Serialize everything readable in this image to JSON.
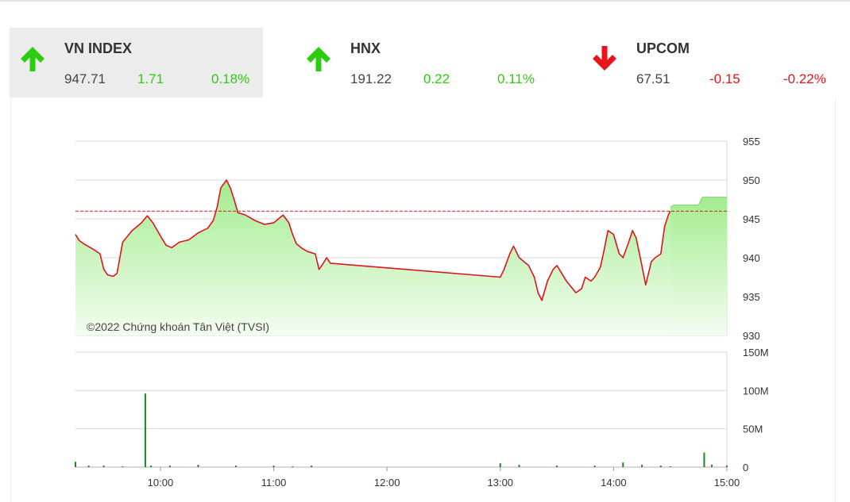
{
  "indices": [
    {
      "name": "VN INDEX",
      "value": "947.71",
      "change": "1.71",
      "pct": "0.18%",
      "direction": "up",
      "active": true
    },
    {
      "name": "HNX",
      "value": "191.22",
      "change": "0.22",
      "pct": "0.11%",
      "direction": "up",
      "active": false
    },
    {
      "name": "UPCOM",
      "value": "67.51",
      "change": "-0.15",
      "pct": "-0.22%",
      "direction": "down",
      "active": false
    }
  ],
  "colors": {
    "up": "#2ecc0e",
    "down": "#e8141c",
    "line": "#e0141c",
    "area_top": "#a3ec8f",
    "area_bottom": "#f4fdf1",
    "volume": "#1a8a1a",
    "grid": "#d9d9d9",
    "reference": "#e0141c"
  },
  "chart_data": {
    "type": "line",
    "copyright": "©2022 Chứng khoán Tân Việt (TVSI)",
    "reference_value": 946,
    "price_axis": {
      "min": 930,
      "max": 955,
      "ticks": [
        "955",
        "950",
        "945",
        "940",
        "935",
        "930"
      ]
    },
    "volume_axis": {
      "min": 0,
      "max": 150,
      "unit": "M",
      "ticks": [
        "150M",
        "100M",
        "50M",
        "0"
      ]
    },
    "time_axis": {
      "start": "09:15",
      "end": "15:00",
      "ticks": [
        "10:00",
        "11:00",
        "12:00",
        "13:00",
        "14:00",
        "15:00"
      ]
    },
    "series": [
      {
        "values": [
          [
            "09:15",
            943.0
          ],
          [
            "09:17",
            942.2
          ],
          [
            "09:20",
            941.7
          ],
          [
            "09:25",
            941.0
          ],
          [
            "09:28",
            940.5
          ],
          [
            "09:30",
            938.5
          ],
          [
            "09:32",
            937.8
          ],
          [
            "09:35",
            937.6
          ],
          [
            "09:37",
            938.0
          ],
          [
            "09:40",
            942.0
          ],
          [
            "09:45",
            943.5
          ],
          [
            "09:50",
            944.5
          ],
          [
            "09:53",
            945.4
          ],
          [
            "09:56",
            944.5
          ],
          [
            "10:00",
            942.8
          ],
          [
            "10:03",
            941.6
          ],
          [
            "10:06",
            941.3
          ],
          [
            "10:10",
            942.0
          ],
          [
            "10:15",
            942.3
          ],
          [
            "10:20",
            943.2
          ],
          [
            "10:25",
            943.8
          ],
          [
            "10:28",
            944.8
          ],
          [
            "10:30",
            946.5
          ],
          [
            "10:32",
            949.0
          ],
          [
            "10:35",
            950.0
          ],
          [
            "10:37",
            949.0
          ],
          [
            "10:39",
            947.5
          ],
          [
            "10:41",
            945.8
          ],
          [
            "10:45",
            945.5
          ],
          [
            "10:50",
            944.8
          ],
          [
            "10:55",
            944.3
          ],
          [
            "11:00",
            944.5
          ],
          [
            "11:03",
            945.1
          ],
          [
            "11:05",
            945.5
          ],
          [
            "11:08",
            944.5
          ],
          [
            "11:10",
            943.0
          ],
          [
            "11:12",
            941.8
          ],
          [
            "11:15",
            941.2
          ],
          [
            "11:18",
            940.8
          ],
          [
            "11:22",
            940.5
          ],
          [
            "11:24",
            938.5
          ],
          [
            "11:26",
            939.2
          ],
          [
            "11:28",
            940.0
          ],
          [
            "11:30",
            939.3
          ],
          [
            "13:00",
            937.5
          ],
          [
            "13:02",
            938.5
          ],
          [
            "13:05",
            940.5
          ],
          [
            "13:07",
            941.5
          ],
          [
            "13:10",
            940.0
          ],
          [
            "13:15",
            939.0
          ],
          [
            "13:18",
            937.5
          ],
          [
            "13:20",
            935.5
          ],
          [
            "13:22",
            934.5
          ],
          [
            "13:25",
            937.0
          ],
          [
            "13:28",
            938.5
          ],
          [
            "13:30",
            939.0
          ],
          [
            "13:35",
            937.0
          ],
          [
            "13:40",
            935.5
          ],
          [
            "13:43",
            936.0
          ],
          [
            "13:45",
            937.5
          ],
          [
            "13:48",
            937.0
          ],
          [
            "13:50",
            937.5
          ],
          [
            "13:53",
            938.8
          ],
          [
            "13:55",
            941.0
          ],
          [
            "13:57",
            943.5
          ],
          [
            "14:00",
            943.0
          ],
          [
            "14:03",
            940.5
          ],
          [
            "14:05",
            940.0
          ],
          [
            "14:08",
            942.0
          ],
          [
            "14:10",
            943.5
          ],
          [
            "14:12",
            942.5
          ],
          [
            "14:15",
            939.0
          ],
          [
            "14:17",
            936.5
          ],
          [
            "14:20",
            939.5
          ],
          [
            "14:22",
            940.0
          ],
          [
            "14:25",
            940.5
          ],
          [
            "14:27",
            944.0
          ],
          [
            "14:29",
            945.5
          ],
          [
            "14:30",
            946.0
          ]
        ]
      },
      {
        "values": [
          [
            "14:30",
            946.5
          ],
          [
            "14:32",
            946.8
          ],
          [
            "14:45",
            946.8
          ],
          [
            "14:47",
            947.8
          ],
          [
            "15:00",
            947.8
          ]
        ]
      }
    ],
    "volume": [
      [
        "09:15",
        7
      ],
      [
        "09:22",
        2
      ],
      [
        "09:30",
        2
      ],
      [
        "09:40",
        1
      ],
      [
        "09:52",
        96
      ],
      [
        "09:55",
        2
      ],
      [
        "10:05",
        2
      ],
      [
        "10:20",
        3
      ],
      [
        "10:40",
        2
      ],
      [
        "11:00",
        2
      ],
      [
        "11:10",
        1
      ],
      [
        "11:20",
        2
      ],
      [
        "13:00",
        5
      ],
      [
        "13:10",
        3
      ],
      [
        "13:30",
        2
      ],
      [
        "13:50",
        2
      ],
      [
        "14:05",
        6
      ],
      [
        "14:15",
        3
      ],
      [
        "14:25",
        2
      ],
      [
        "14:30",
        1
      ],
      [
        "14:48",
        19
      ],
      [
        "14:52",
        3
      ],
      [
        "15:00",
        2
      ]
    ]
  }
}
